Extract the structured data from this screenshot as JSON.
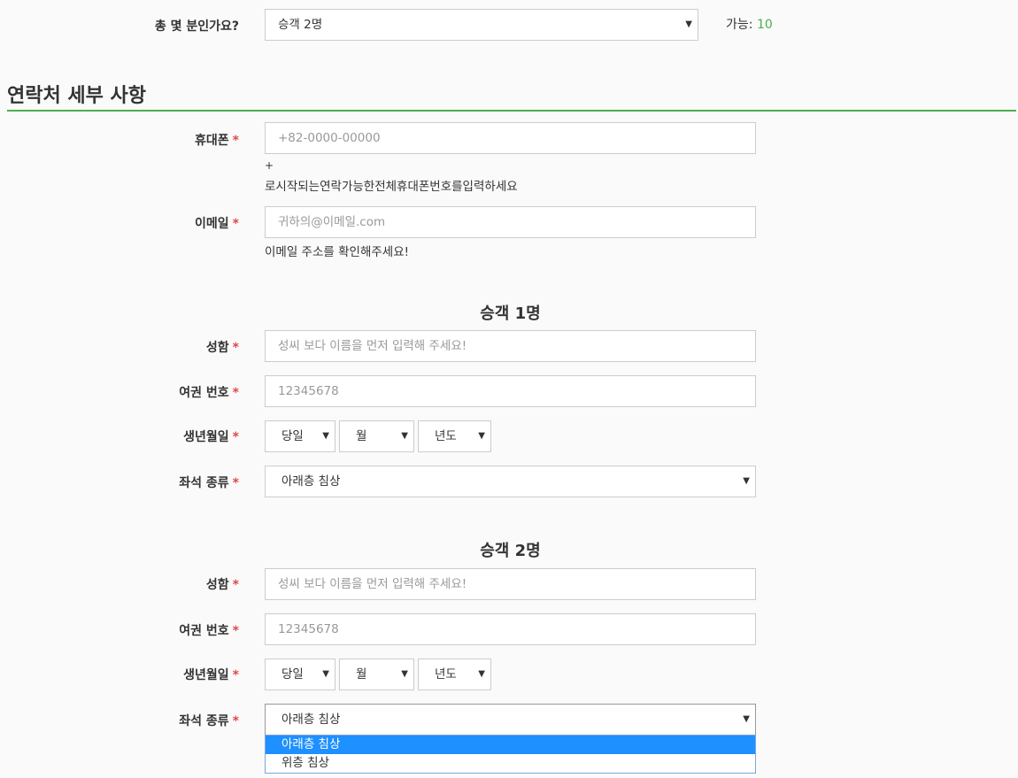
{
  "passenger_count": {
    "label": "총 몇 분인가요?",
    "selected": "승객 2명",
    "available_label": "가능:",
    "available_count": "10"
  },
  "contact": {
    "title": "연락처 세부 사항",
    "phone_label": "휴대폰",
    "phone_placeholder": "+82-0000-00000",
    "phone_help_plus": "+",
    "phone_help": "로시작되는연락가능한전체휴대폰번호를입력하세요",
    "email_label": "이메일",
    "email_placeholder": "귀하의@이메일.com",
    "email_help": "이메일 주소를 확인해주세요!"
  },
  "required_mark": "*",
  "passengers": [
    {
      "title": "승객 1명",
      "name_label": "성함",
      "name_placeholder": "성씨 보다 이름을 먼저 입력해 주세요!",
      "passport_label": "여권 번호",
      "passport_placeholder": "12345678",
      "birth_label": "생년월일",
      "day": "당일",
      "month": "월",
      "year": "년도",
      "seat_label": "좌석 종류",
      "seat_selected": "아래층 침상"
    },
    {
      "title": "승객 2명",
      "name_label": "성함",
      "name_placeholder": "성씨 보다 이름을 먼저 입력해 주세요!",
      "passport_label": "여권 번호",
      "passport_placeholder": "12345678",
      "birth_label": "생년월일",
      "day": "당일",
      "month": "월",
      "year": "년도",
      "seat_label": "좌석 종류",
      "seat_selected": "아래층 침상"
    }
  ],
  "seat_options": [
    "아래층 침상",
    "위층 침상"
  ],
  "colors": {
    "accent": "#4caf50",
    "required": "#e04848",
    "highlight": "#1e90ff"
  }
}
